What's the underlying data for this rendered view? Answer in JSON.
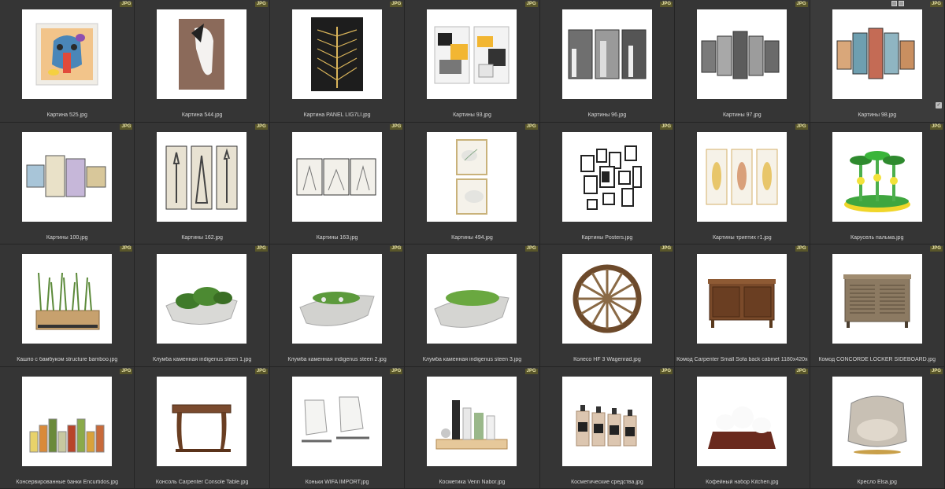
{
  "badge_label": "JPG",
  "items": [
    {
      "name": "Картина 525.jpg",
      "icon": "elephant-painting"
    },
    {
      "name": "Картина 544.jpg",
      "icon": "horse-painting"
    },
    {
      "name": "Картина PANEL LIG7LI.jpg",
      "icon": "gold-tree-panel"
    },
    {
      "name": "Картины 93.jpg",
      "icon": "abstract-diptych"
    },
    {
      "name": "Картины 96.jpg",
      "icon": "city-triptych"
    },
    {
      "name": "Картины 97.jpg",
      "icon": "five-panel-gray"
    },
    {
      "name": "Картины 98.jpg",
      "icon": "five-panel-color"
    },
    {
      "name": "Картины 100.jpg",
      "icon": "four-panel-abstract"
    },
    {
      "name": "Картины 162.jpg",
      "icon": "towers-triptych"
    },
    {
      "name": "Картины 163.jpg",
      "icon": "sketch-triptych"
    },
    {
      "name": "Картины 494.jpg",
      "icon": "flower-diptych"
    },
    {
      "name": "Картины Posters.jpg",
      "icon": "poster-wall"
    },
    {
      "name": "Картины триптих г1.jpg",
      "icon": "leaf-triptych"
    },
    {
      "name": "Карусель пальма.jpg",
      "icon": "palm-carousel"
    },
    {
      "name": "Кашпо с бамбуком structure bamboo.jpg",
      "icon": "bamboo-planter"
    },
    {
      "name": "Клумба каменная indigenus steen 1.jpg",
      "icon": "stone-planter-1"
    },
    {
      "name": "Клумба каменная indigenus steen 2.jpg",
      "icon": "stone-planter-2"
    },
    {
      "name": "Клумба каменная indigenus steen 3.jpg",
      "icon": "stone-planter-3"
    },
    {
      "name": "Колесо HF 3 Wagenrad.jpg",
      "icon": "wagon-wheel"
    },
    {
      "name": "Комод Carpenter Small Sofa back cabinet 1180x420x800.jpg",
      "icon": "carved-cabinet"
    },
    {
      "name": "Комод CONCORDE LOCKER SIDEBOARD.jpg",
      "icon": "louvered-sideboard"
    },
    {
      "name": "Консервированные банки Encurtidos.jpg",
      "icon": "preserve-jars"
    },
    {
      "name": "Консоль Carpenter Console Table.jpg",
      "icon": "console-table"
    },
    {
      "name": "Коньки WIFA IMPORT.jpg",
      "icon": "ice-skates"
    },
    {
      "name": "Косметика Venn Nabor.jpg",
      "icon": "cosmetics-tray"
    },
    {
      "name": "Косметические средства.jpg",
      "icon": "pump-bottles"
    },
    {
      "name": "Кофейный набор Kitchen.jpg",
      "icon": "coffee-set"
    },
    {
      "name": "Кресло Elsa.jpg",
      "icon": "armchair"
    }
  ]
}
